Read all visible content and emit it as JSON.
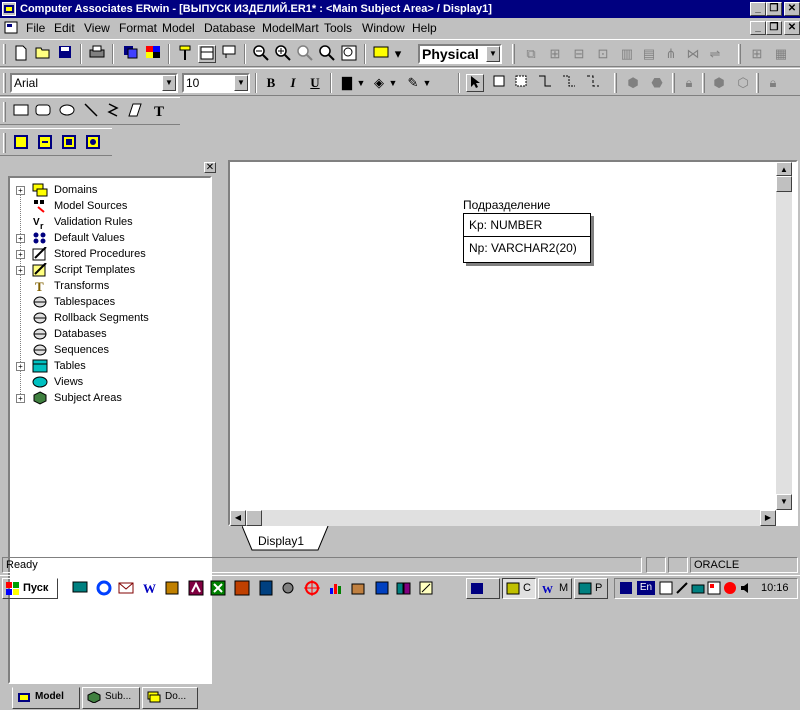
{
  "window": {
    "title": "Computer Associates ERwin - [ВЫПУСК ИЗДЕЛИЙ.ER1* : <Main Subject Area> / Display1]"
  },
  "menu": [
    "File",
    "Edit",
    "View",
    "Format",
    "Model",
    "Database",
    "ModelMart",
    "Tools",
    "Window",
    "Help"
  ],
  "toolbar": {
    "model_type": "Physical",
    "font_name": "Arial",
    "font_size": "10",
    "bold": "B",
    "italic": "I",
    "underline": "U",
    "text_tool": "T"
  },
  "tree": {
    "items": [
      {
        "label": "Domains",
        "expandable": true,
        "icon": "domains-icon"
      },
      {
        "label": "Model Sources",
        "expandable": false,
        "icon": "model-sources-icon"
      },
      {
        "label": "Validation Rules",
        "expandable": false,
        "icon": "validation-rules-icon"
      },
      {
        "label": "Default Values",
        "expandable": true,
        "icon": "default-values-icon"
      },
      {
        "label": "Stored Procedures",
        "expandable": true,
        "icon": "stored-procedures-icon"
      },
      {
        "label": "Script Templates",
        "expandable": true,
        "icon": "script-templates-icon"
      },
      {
        "label": "Transforms",
        "expandable": false,
        "icon": "transforms-icon"
      },
      {
        "label": "Tablespaces",
        "expandable": false,
        "icon": "tablespaces-icon"
      },
      {
        "label": "Rollback Segments",
        "expandable": false,
        "icon": "rollback-segments-icon"
      },
      {
        "label": "Databases",
        "expandable": false,
        "icon": "databases-icon"
      },
      {
        "label": "Sequences",
        "expandable": false,
        "icon": "sequences-icon"
      },
      {
        "label": "Tables",
        "expandable": true,
        "icon": "tables-icon"
      },
      {
        "label": "Views",
        "expandable": false,
        "icon": "views-icon"
      },
      {
        "label": "Subject Areas",
        "expandable": true,
        "icon": "subject-areas-icon"
      }
    ],
    "tabs": [
      "Model",
      "Sub...",
      "Do..."
    ]
  },
  "diagram": {
    "entity_name": "Подразделение",
    "key_attribute": "Kp: NUMBER",
    "nonkey_attribute": "Np: VARCHAR2(20)",
    "display_tab": "Display1"
  },
  "status": {
    "text": "Ready",
    "database": "ORACLE"
  },
  "taskbar": {
    "start": "Пуск",
    "buttons": [
      "",
      "C",
      "M",
      "P"
    ],
    "clock": "10:16",
    "lang": "En"
  }
}
